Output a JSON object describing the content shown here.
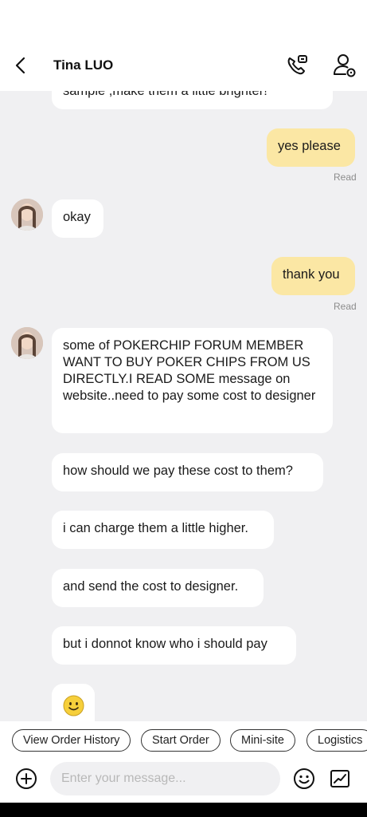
{
  "header": {
    "title": "Tina LUO",
    "back_icon": "chevron-left-icon",
    "call_icon": "phone-call-icon",
    "profile_icon": "user-settings-icon"
  },
  "chat": {
    "partial_message": "sample ,make them a little brighter!",
    "messages": [
      {
        "side": "out",
        "text": "yes please",
        "status": "Read"
      },
      {
        "side": "in",
        "text": "okay",
        "avatar": true
      },
      {
        "side": "out",
        "text": "thank you",
        "status": "Read"
      },
      {
        "side": "in",
        "text": "some of POKERCHIP FORUM MEMBER WANT TO BUY POKER CHIPS FROM US DIRECTLY.I READ SOME message on website..need to pay some cost to designer",
        "avatar": true
      },
      {
        "side": "in",
        "text": "how should we pay these cost to them?"
      },
      {
        "side": "in",
        "text": "i can charge them a little higher."
      },
      {
        "side": "in",
        "text": "and send the cost to designer."
      },
      {
        "side": "in",
        "text": "but i donnot know who i should pay"
      },
      {
        "side": "in",
        "text": "",
        "emoji": "smiley-face-emoji"
      }
    ]
  },
  "quick_actions": [
    "View Order History",
    "Start Order",
    "Mini-site",
    "Logistics"
  ],
  "composer": {
    "placeholder": "Enter your message...",
    "plus_icon": "plus-circle-icon",
    "emoji_icon": "smiley-icon",
    "media_icon": "image-icon"
  },
  "colors": {
    "chat_background": "#f0f0f2",
    "outgoing_bubble": "#fbe7a4",
    "incoming_bubble": "#ffffff"
  }
}
